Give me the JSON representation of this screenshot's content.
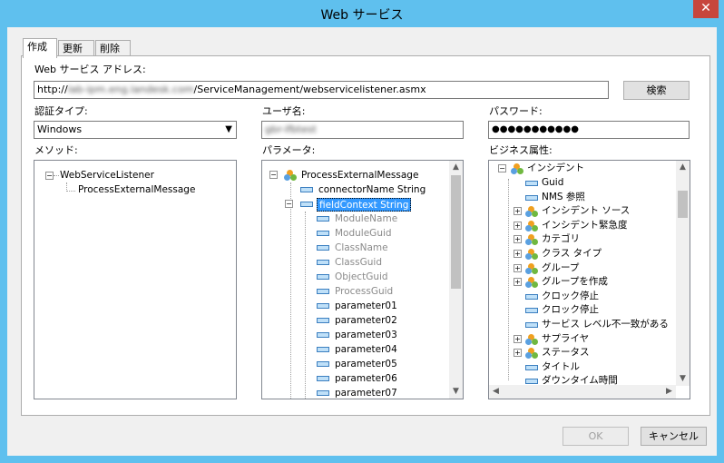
{
  "window": {
    "title": "Web サービス",
    "close_glyph": "✕"
  },
  "tabs": [
    {
      "label": "作成"
    },
    {
      "label": "更新"
    },
    {
      "label": "削除"
    }
  ],
  "address": {
    "label": "Web サービス アドレス:",
    "prefix": "http://",
    "host_blurred": "lab-ipm.eng.landesk.com",
    "path": "/ServiceManagement/webservicelistener.asmx",
    "search_button": "検索"
  },
  "auth": {
    "label": "認証タイプ:",
    "value": "Windows"
  },
  "user": {
    "label": "ユーザ名:",
    "value_blurred": "gbr-ifbtest"
  },
  "password": {
    "label": "パスワード:",
    "value": "●●●●●●●●●●●"
  },
  "methods": {
    "label": "メソッド:",
    "root": "WebServiceListener",
    "child": "ProcessExternalMessage"
  },
  "params": {
    "label": "パラメータ:",
    "root": "ProcessExternalMessage",
    "items": [
      "connectorName String",
      "fieldContext String"
    ],
    "sub_dim": [
      "ModuleName",
      "ModuleGuid",
      "ClassName",
      "ClassGuid",
      "ObjectGuid",
      "ProcessGuid"
    ],
    "sub": [
      "parameter01",
      "parameter02",
      "parameter03",
      "parameter04",
      "parameter05",
      "parameter06",
      "parameter07"
    ]
  },
  "business": {
    "label": "ビジネス属性:",
    "root": "インシデント",
    "items": [
      {
        "label": "Guid",
        "kind": "field"
      },
      {
        "label": "NMS 参照",
        "kind": "field"
      },
      {
        "label": "インシデント ソース",
        "kind": "obj"
      },
      {
        "label": "インシデント緊急度",
        "kind": "obj"
      },
      {
        "label": "カテゴリ",
        "kind": "obj"
      },
      {
        "label": "クラス タイプ",
        "kind": "obj"
      },
      {
        "label": "グループ",
        "kind": "obj"
      },
      {
        "label": "グループを作成",
        "kind": "obj"
      },
      {
        "label": "クロック停止",
        "kind": "field"
      },
      {
        "label": "クロック停止",
        "kind": "field"
      },
      {
        "label": "サービス レベル不一致がある",
        "kind": "field"
      },
      {
        "label": "サプライヤ",
        "kind": "obj"
      },
      {
        "label": "ステータス",
        "kind": "obj"
      },
      {
        "label": "タイトル",
        "kind": "field"
      },
      {
        "label": "ダウンタイム時間",
        "kind": "field"
      }
    ]
  },
  "footer": {
    "ok": "OK",
    "cancel": "キャンセル"
  },
  "colors": {
    "accent": "#5fc0ee",
    "selection": "#3399ff",
    "close": "#c7463d"
  }
}
